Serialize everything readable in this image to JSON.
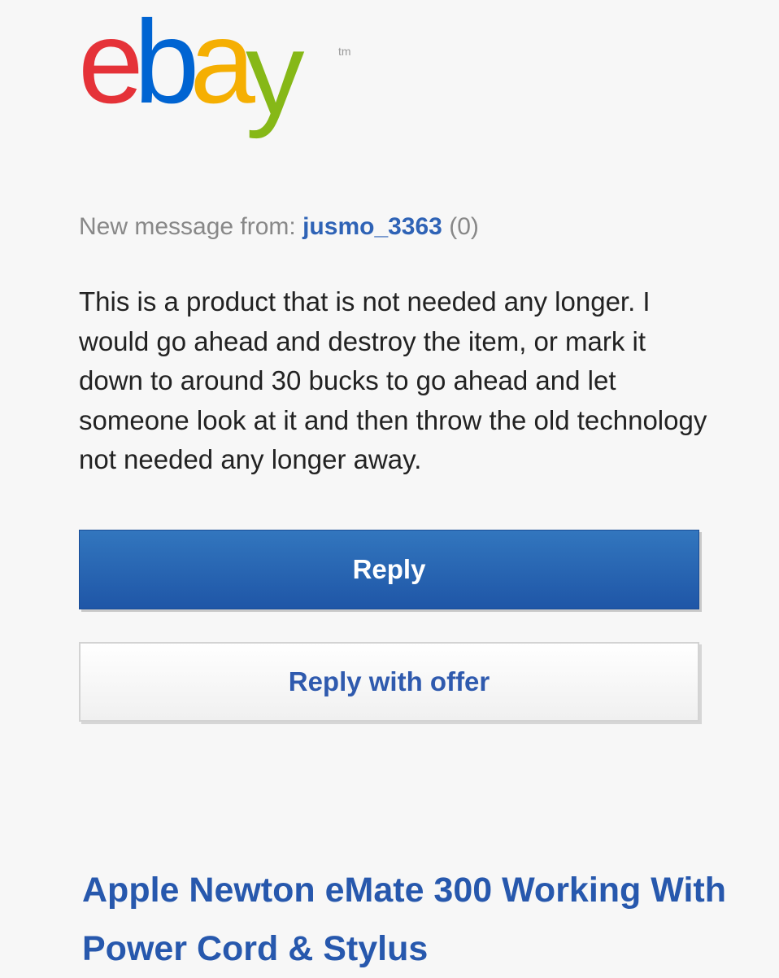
{
  "logo": {
    "letters": [
      {
        "char": "e",
        "color": "#e53238"
      },
      {
        "char": "b",
        "color": "#0064d2"
      },
      {
        "char": "a",
        "color": "#f5af02"
      },
      {
        "char": "y",
        "color": "#86b817"
      }
    ],
    "trademark": "tm"
  },
  "message": {
    "header_prefix": "New message from:",
    "sender": "jusmo_3363",
    "feedback": "(0)",
    "body": "This is a product that is not needed any longer. I would go ahead and destroy the item, or mark it down to around 30 bucks to go ahead and let someone look at it and then throw the old technology not needed any longer away."
  },
  "actions": {
    "reply_label": "Reply",
    "reply_offer_label": "Reply with offer"
  },
  "item": {
    "title": "Apple Newton eMate 300 Working With Power Cord & Stylus"
  },
  "colors": {
    "accent_blue": "#2f63b6",
    "button_blue": "#2762b0"
  }
}
